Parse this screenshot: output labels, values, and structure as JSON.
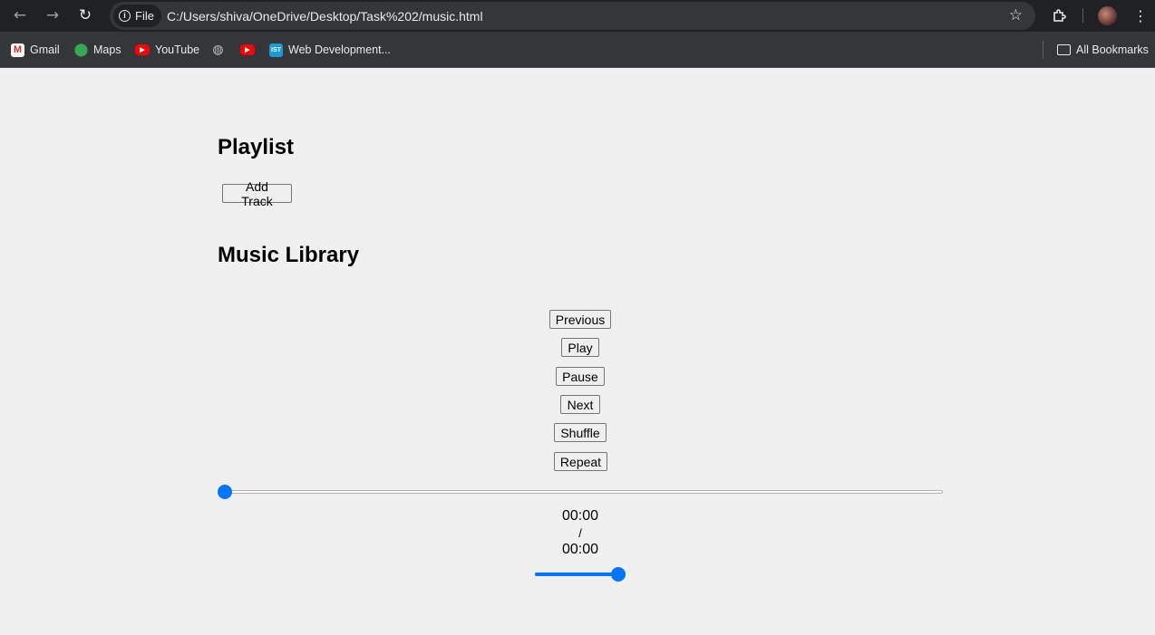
{
  "browser": {
    "chip_label": "File",
    "url": "C:/Users/shiva/OneDrive/Desktop/Task%202/music.html"
  },
  "bookmarks": [
    {
      "label": "Gmail",
      "icon": "gmail-icon"
    },
    {
      "label": "Maps",
      "icon": "maps-icon"
    },
    {
      "label": "YouTube",
      "icon": "youtube-icon"
    },
    {
      "label": "",
      "icon": "globe-icon"
    },
    {
      "label": "",
      "icon": "youtube-icon"
    },
    {
      "label": "Web Development...",
      "icon": "ist-icon"
    }
  ],
  "all_bookmarks_label": "All Bookmarks",
  "page": {
    "playlist_heading": "Playlist",
    "add_track_label": "Add Track",
    "library_heading": "Music Library",
    "controls": {
      "previous": "Previous",
      "play": "Play",
      "pause": "Pause",
      "next": "Next",
      "shuffle": "Shuffle",
      "repeat": "Repeat"
    },
    "progress": 0,
    "current_time": "00:00",
    "separator": "/",
    "duration": "00:00",
    "volume": 1
  },
  "colors": {
    "accent": "#0075ff",
    "page_bg": "#f0f0f0",
    "chrome_bg": "#202124"
  }
}
